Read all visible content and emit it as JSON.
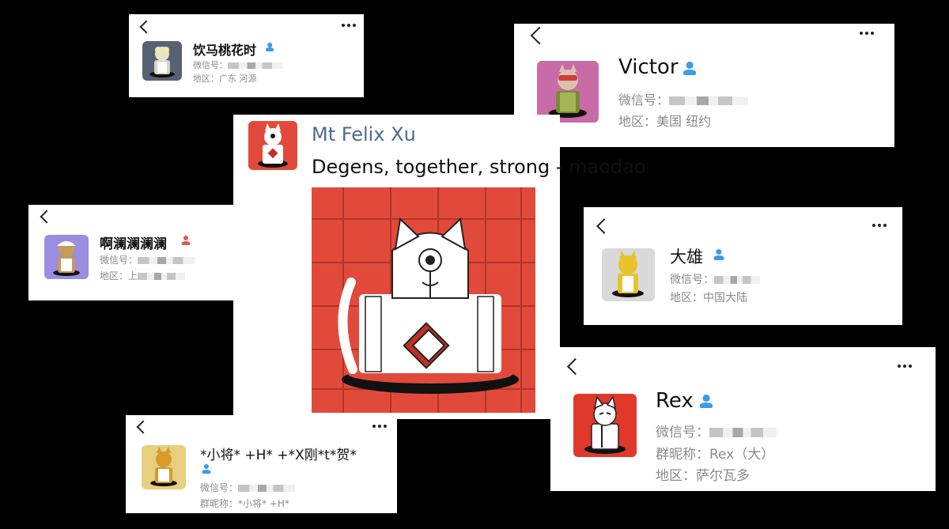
{
  "cards": {
    "yinma": {
      "name": "饮马桃花时",
      "wechat_label": "微信号：",
      "region": "地区：广东 河源"
    },
    "victor": {
      "name": "Victor",
      "wechat_label": "微信号：",
      "region": "地区：美国 纽约"
    },
    "alan": {
      "name": "啊澜澜澜澜",
      "wechat_label": "微信号：",
      "region": "地区：上"
    },
    "daxiong": {
      "name": "大雄",
      "wechat_label": "微信号：",
      "region": "地区：中国大陆"
    },
    "xiaojiang": {
      "name": "*小将*  +H* +*X刚*t*贺*",
      "wechat_label": "微信号：",
      "nickname": "群昵称：*小将*  +H*"
    },
    "rex": {
      "name": "Rex",
      "wechat_label": "微信号：",
      "nickname": "群昵称：Rex（大）",
      "region": "地区：萨尔瓦多"
    }
  },
  "post": {
    "author": "Mt Felix Xu",
    "text": "Degens, together, strong - maodao"
  },
  "icons": {
    "contact_badge": "person-icon",
    "back": "chevron-left-icon",
    "more": "more-dots-icon"
  },
  "colors": {
    "badge_blue": "#3d9be9",
    "badge_red": "#e05a4d",
    "author_blue": "#4a6a96",
    "art_red": "#e14a3a"
  }
}
